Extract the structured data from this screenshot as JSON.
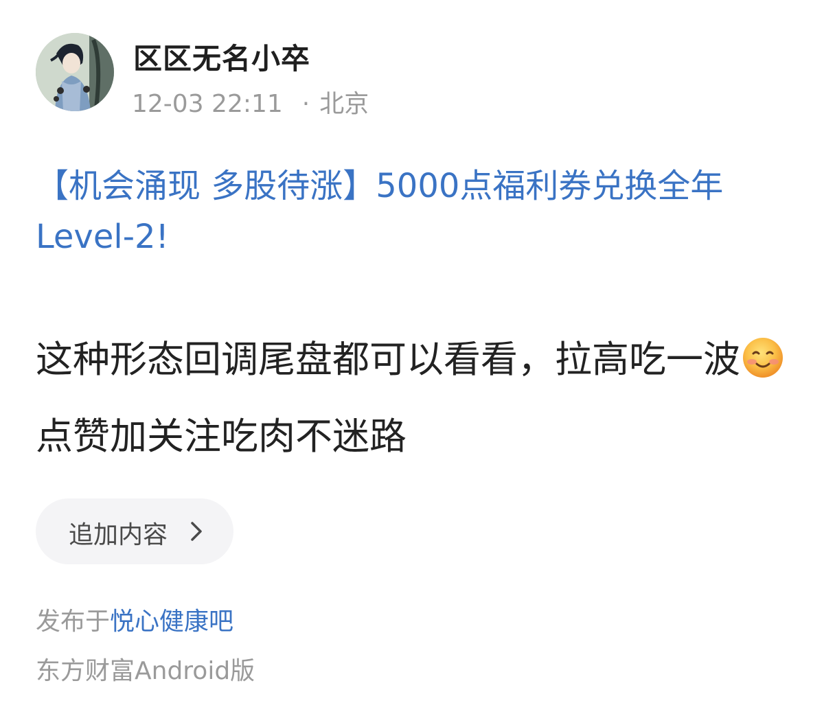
{
  "author": {
    "name": "区区无名小卒",
    "avatar": "avatar-image"
  },
  "meta": {
    "time": "12-03 22:11",
    "separator": "·",
    "location": "北京"
  },
  "title": "【机会涌现 多股待涨】5000点福利券兑换全年Level-2!",
  "body": {
    "text_part1": "这种形态回调尾盘都可以看看，拉高吃一波",
    "emoji": "smile-icon",
    "text_part2": "点赞加关注吃肉不迷路"
  },
  "append_button": {
    "label": "追加内容",
    "icon": "chevron-right-icon"
  },
  "footer": {
    "published_prefix": "发布于",
    "bar_name": "悦心健康吧",
    "client": "东方财富Android版"
  },
  "colors": {
    "link": "#3a73c4",
    "muted": "#9a9a9a",
    "text": "#222222",
    "button_bg": "#f4f4f6"
  }
}
